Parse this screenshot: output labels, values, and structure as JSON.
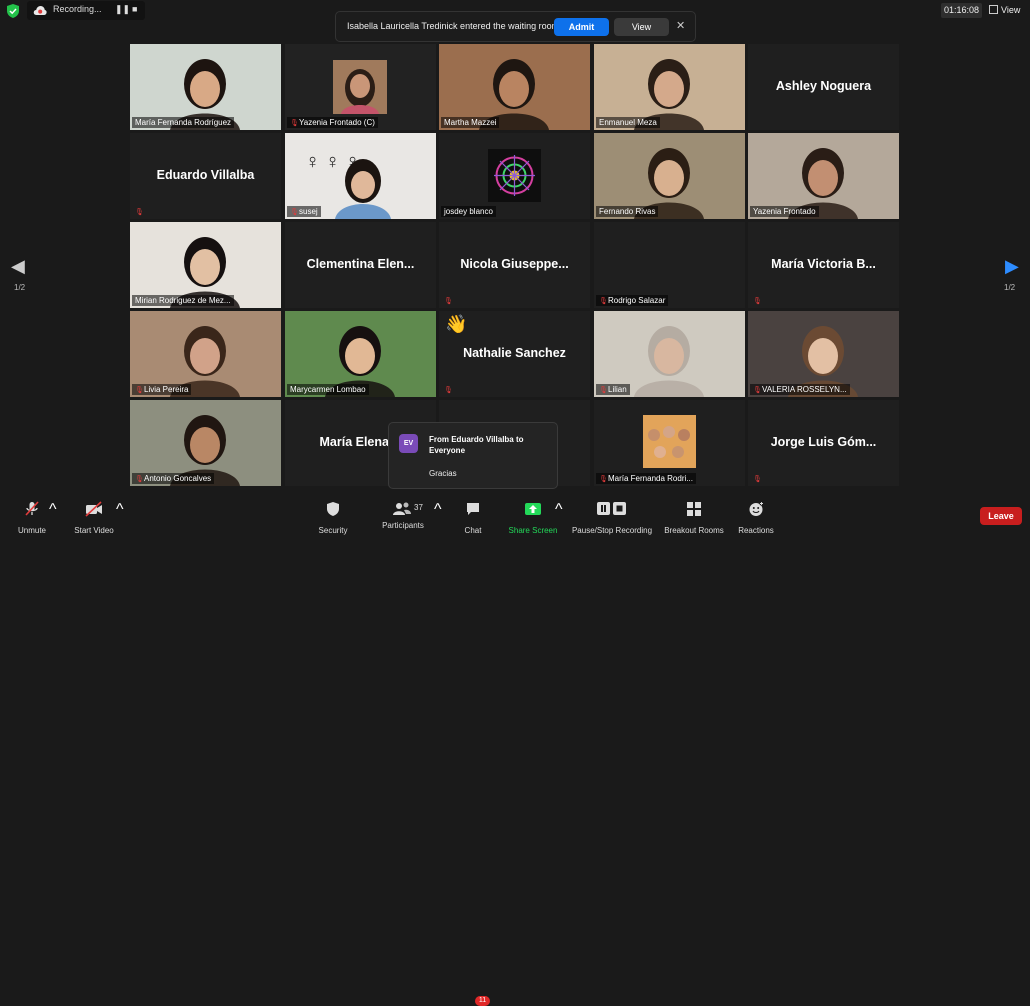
{
  "recording": {
    "label": "Recording...",
    "pause_symbol": "❚❚",
    "stop_symbol": "■"
  },
  "timer": "01:16:08",
  "view_label": "View",
  "notification": {
    "text": "Isabella Lauricella Tredinick entered the waiting room",
    "admit_label": "Admit",
    "view_label": "View",
    "close_symbol": "✕"
  },
  "pager": {
    "left": "1/2",
    "right": "1/2"
  },
  "tiles": [
    {
      "name": "María Fernanda Rodríguez",
      "video": true,
      "muted": false,
      "bg": "#cfd6cf",
      "skin": "#d8a986",
      "hair": "#1d1410"
    },
    {
      "name": "Yazenia Frontado (C)",
      "video": true,
      "muted": true,
      "bg": "#222222",
      "skin": "#c99678",
      "hair": "#2a1d16"
    },
    {
      "name": "Martha Mazzei",
      "video": true,
      "muted": false,
      "highlight": true,
      "bg": "#9b6e4e",
      "skin": "#b98461",
      "hair": "#1e1611"
    },
    {
      "name": "Enmanuel Meza",
      "video": true,
      "muted": false,
      "bg": "#c7b094",
      "skin": "#d4a98b",
      "hair": "#2a1e16"
    },
    {
      "name": "",
      "bigname": "Ashley Noguera",
      "video": false,
      "muted": false
    },
    {
      "name": "",
      "bigname": "Eduardo Villalba",
      "video": false,
      "muted": true
    },
    {
      "name": "susej",
      "video": true,
      "muted": true,
      "bg": "#e9e7e4",
      "skin": "#e0b89a",
      "hair": "#1b1410"
    },
    {
      "name": "josdey blanco",
      "video": true,
      "muted": false,
      "bg": "#1f1f1f",
      "mandala": true
    },
    {
      "name": "Fernando Rivas",
      "video": true,
      "muted": false,
      "bg": "#9d8e75",
      "skin": "#d8b08f",
      "hair": "#2b1e14"
    },
    {
      "name": "Yazenia Frontado",
      "video": true,
      "muted": false,
      "bg": "#b4a89a",
      "skin": "#c28f72",
      "hair": "#2a1d16"
    },
    {
      "name": "Mirian Rodriguez de Mez...",
      "video": true,
      "muted": false,
      "bg": "#e6e2dc",
      "skin": "#e2c0a3",
      "hair": "#151010"
    },
    {
      "name": "",
      "bigname": "Clementina  Elen...",
      "video": false,
      "muted": false
    },
    {
      "name": "",
      "bigname": "Nicola  Giuseppe...",
      "video": false,
      "muted": true
    },
    {
      "name": "Rodrigo Salazar",
      "video": false,
      "muted": true,
      "bigname": ""
    },
    {
      "name": "",
      "bigname": "María Victoria B...",
      "video": false,
      "muted": true
    },
    {
      "name": "Livia Pereira",
      "video": true,
      "muted": true,
      "bg": "#a98b73",
      "skin": "#d1a289",
      "hair": "#3a261a"
    },
    {
      "name": "Marycarmen Lombao",
      "video": true,
      "muted": false,
      "bg": "#5f8a4e",
      "skin": "#e1b895",
      "hair": "#161010"
    },
    {
      "name": "",
      "bigname": "Nathalie Sanchez",
      "video": false,
      "muted": true,
      "wave": "👋"
    },
    {
      "name": "Lilian",
      "video": true,
      "muted": true,
      "bg": "#cfcac0",
      "skin": "#d8b7a0",
      "hair": "#b5aca2"
    },
    {
      "name": "VALERIA ROSSELYN...",
      "video": true,
      "muted": true,
      "bg": "#4a4240",
      "skin": "#e3c0a4",
      "hair": "#6b4a33"
    },
    {
      "name": "Antonio Goncalves",
      "video": true,
      "muted": true,
      "bg": "#8d8f7f",
      "skin": "#b98765",
      "hair": "#201611"
    },
    {
      "name": "",
      "bigname": "María  Elena  C",
      "video": false,
      "muted": false
    },
    {
      "name": "",
      "bigname": "",
      "video": false,
      "muted": false
    },
    {
      "name": "María Fernanda Rodri...",
      "video": false,
      "muted": true,
      "group_photo": true
    },
    {
      "name": "",
      "bigname": "Jorge Luis Góm...",
      "video": false,
      "muted": true
    }
  ],
  "chat_popup": {
    "initials": "EV",
    "from": "From Eduardo Villalba to Everyone",
    "message": "Gracias"
  },
  "toolbar": {
    "unmute": "Unmute",
    "start_video": "Start Video",
    "security": "Security",
    "participants": "Participants",
    "participants_count": "37",
    "chat": "Chat",
    "chat_badge": "11",
    "share_screen": "Share Screen",
    "pause_recording": "Pause/Stop Recording",
    "breakout_rooms": "Breakout Rooms",
    "reactions": "Reactions",
    "leave": "Leave"
  },
  "colors": {
    "accent": "#0e71eb",
    "share": "#23d959",
    "leave": "#c81e1e",
    "highlight": "#d6d83a",
    "muted_icon": "#e23b3b"
  }
}
